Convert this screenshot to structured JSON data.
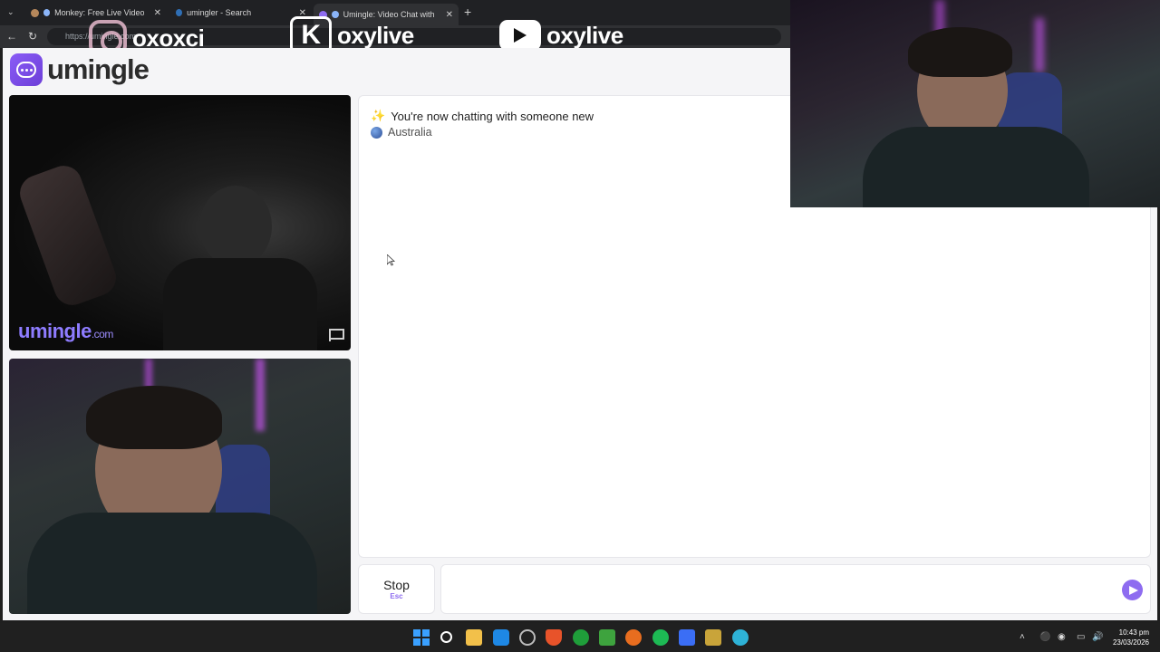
{
  "browser": {
    "tabs": [
      {
        "title": "Monkey: Free Live Video Chat",
        "active": false
      },
      {
        "title": "umingler - Search",
        "active": false
      },
      {
        "title": "Umingle: Video Chat with Stra",
        "active": true
      }
    ],
    "new_tab_symbol": "+",
    "url_prefix": "https://",
    "url": "umingle.com"
  },
  "overlay_handles": {
    "instagram": "oxoxci",
    "kick": "oxylive",
    "youtube": "oxylive",
    "kick_letter": "K"
  },
  "site": {
    "logo_text": "umingle",
    "watermark_main": "umingle",
    "watermark_suffix": ".com"
  },
  "chat": {
    "status_emoji": "✨",
    "status_message": "You're now chatting with someone new",
    "country": "Australia"
  },
  "controls": {
    "stop_label": "Stop",
    "stop_shortcut": "Esc",
    "message_value": "",
    "message_placeholder": ""
  },
  "taskbar": {
    "time": "10:43 pm",
    "date": "23/03/2026"
  },
  "colors": {
    "accent": "#8e6cf0",
    "page_bg": "#f5f5f7",
    "tabbar_bg": "#202124",
    "taskbar_bg": "#202020"
  }
}
